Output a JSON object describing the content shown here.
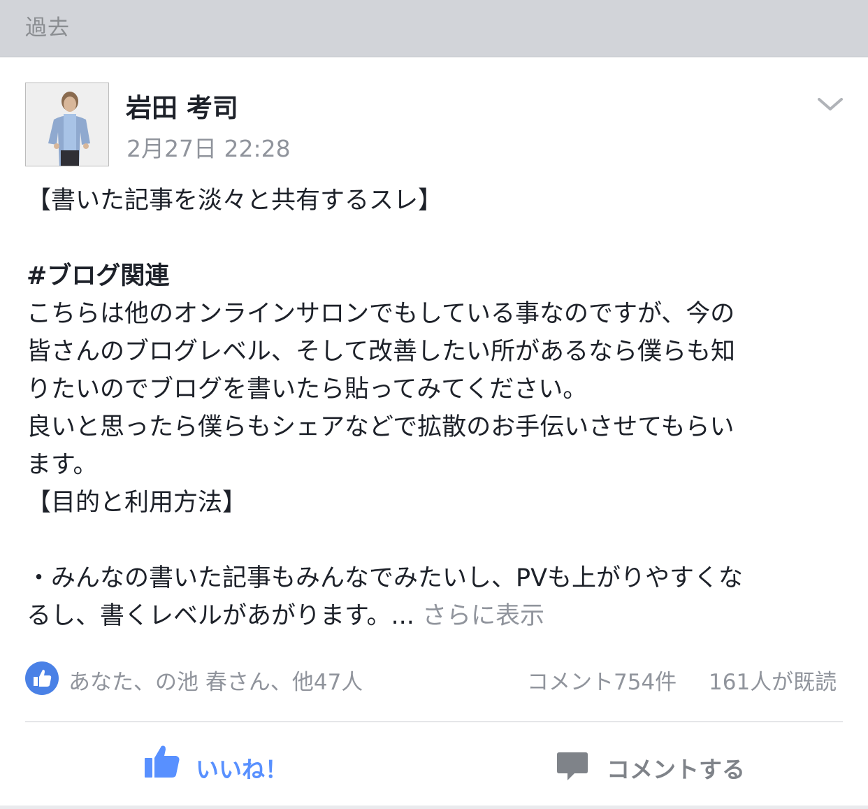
{
  "section_header": {
    "label": "過去"
  },
  "post": {
    "author": "岩田 考司",
    "timestamp": "2月27日 22:28",
    "avatar_icon": "user-photo-icon",
    "menu_icon": "chevron-down-icon",
    "body_lines": [
      "【書いた記事を淡々と共有するスレ】",
      "",
      "#ブログ関連",
      "こちらは他のオンラインサロンでもしている事なのですが、今の",
      "皆さんのブログレベル、そして改善したい所があるなら僕らも知",
      "りたいのでブログを書いたら貼ってみてください。",
      "良いと思ったら僕らもシェアなどで拡散のお手伝いさせてもらい",
      "ます。",
      "【目的と利用方法】",
      "",
      "・みんなの書いた記事もみんなでみたいし、PVも上がりやすくな",
      "るし、書くレベルがあがります。..."
    ],
    "see_more": " さらに表示",
    "reactions": {
      "reactors": "あなた、の池 春さん、他47人",
      "comment_count": "コメント754件",
      "read_count": "161人が既読"
    },
    "actions": {
      "like_label": "いいね！",
      "comment_label": "コメントする"
    }
  },
  "colors": {
    "accent": "#5890ff",
    "like_badge": "#4a81e6",
    "meta_text": "#90949c",
    "header_bg": "#d2d4d9"
  }
}
